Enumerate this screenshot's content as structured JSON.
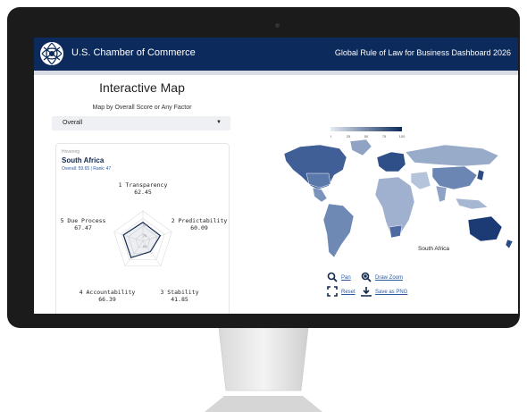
{
  "header": {
    "org_name": "U.S. Chamber of Commerce",
    "dashboard_title": "Global Rule of Law for Business Dashboard 2026"
  },
  "panel": {
    "title": "Interactive Map",
    "map_by_label": "Map by Overall Score or Any Factor",
    "selected_factor": "Overall"
  },
  "card": {
    "hover_label": "Hovering",
    "country": "South Africa",
    "overall_line": "Overall: 59.65 | Rank: 47",
    "factors": [
      {
        "name": "1 Transparency",
        "score": "62.45",
        "value": 62.45
      },
      {
        "name": "2 Predictability",
        "score": "60.09",
        "value": 60.09
      },
      {
        "name": "3 Stability",
        "score": "41.85",
        "value": 41.85
      },
      {
        "name": "4 Accountability",
        "score": "66.39",
        "value": 66.39
      },
      {
        "name": "5 Due Process",
        "score": "67.47",
        "value": 67.47
      }
    ],
    "radar_ticks": [
      "100",
      "75",
      "50"
    ]
  },
  "map": {
    "legend_ticks": [
      "0",
      "25",
      "50",
      "75",
      "100"
    ],
    "tooltip": "South Africa",
    "colors": {
      "low": "#e6ecf4",
      "high": "#0c2a5b"
    }
  },
  "controls": {
    "pan": "Pan",
    "draw_zoom": "Draw Zoom",
    "reset": "Reset",
    "save_png": "Save as PNG"
  }
}
